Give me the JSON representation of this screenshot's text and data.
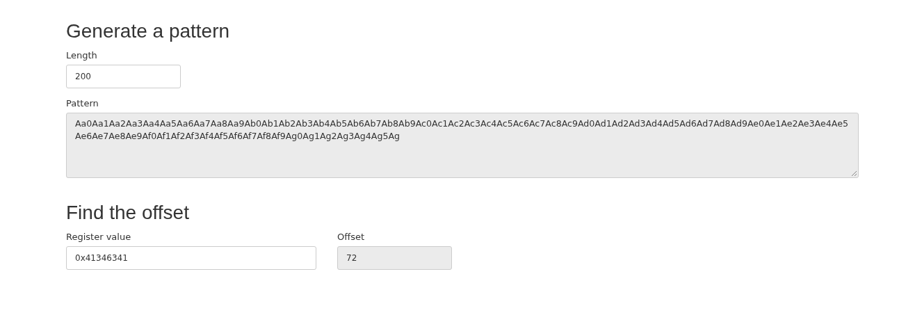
{
  "sections": [
    {
      "heading": "Generate a pattern",
      "rows": [
        {
          "fields": [
            {
              "label": "Length",
              "value": "200",
              "kind": "input",
              "readonly": false
            }
          ]
        },
        {
          "fields": [
            {
              "label": "Pattern",
              "value": "Aa0Aa1Aa2Aa3Aa4Aa5Aa6Aa7Aa8Aa9Ab0Ab1Ab2Ab3Ab4Ab5Ab6Ab7Ab8Ab9Ac0Ac1Ac2Ac3Ac4Ac5Ac6Ac7Ac8Ac9Ad0Ad1Ad2Ad3Ad4Ad5Ad6Ad7Ad8Ad9Ae0Ae1Ae2Ae3Ae4Ae5Ae6Ae7Ae8Ae9Af0Af1Af2Af3Af4Af5Af6Af7Af8Af9Ag0Ag1Ag2Ag3Ag4Ag5Ag",
              "kind": "textarea",
              "readonly": true
            }
          ]
        }
      ]
    },
    {
      "heading": "Find the offset",
      "rows": [
        {
          "fields": [
            {
              "label": "Register value",
              "value": "0x41346341",
              "kind": "input",
              "readonly": false
            },
            {
              "label": "Offset",
              "value": "72",
              "kind": "input",
              "readonly": true
            }
          ]
        }
      ]
    }
  ]
}
